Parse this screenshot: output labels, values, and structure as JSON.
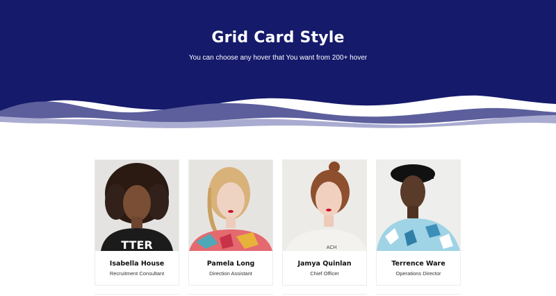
{
  "hero": {
    "title": "Grid Card Style",
    "subtitle": "You can choose any hover that You want from 200+ hover",
    "background_color": "#161a6b",
    "wave_color": "#a9abd0"
  },
  "cards": [
    {
      "name": "Isabella House",
      "role": "Recruitment Consultant"
    },
    {
      "name": "Pamela Long",
      "role": "Direction Assistant"
    },
    {
      "name": "Jamya Quinlan",
      "role": "Chief Officer"
    },
    {
      "name": "Terrence Ware",
      "role": "Operations Director"
    }
  ]
}
